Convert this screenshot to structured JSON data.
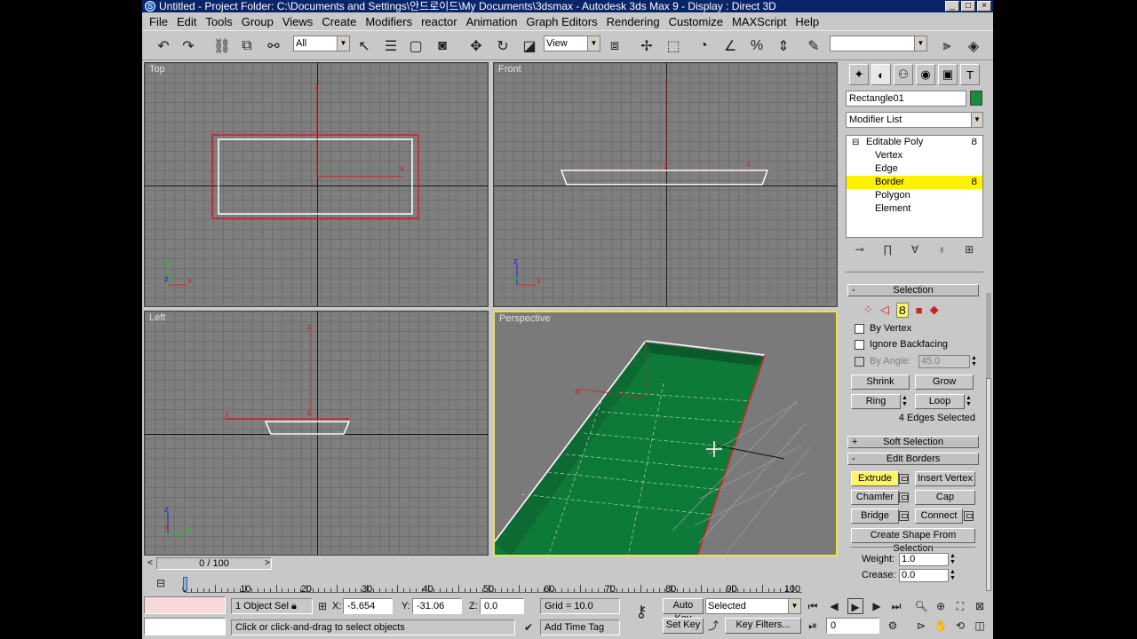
{
  "window": {
    "title": "Untitled      - Project Folder: C:\\Documents and Settings\\안드로이드\\My Documents\\3dsmax      - Autodesk 3ds Max 9      - Display : Direct 3D"
  },
  "menu": [
    "File",
    "Edit",
    "Tools",
    "Group",
    "Views",
    "Create",
    "Modifiers",
    "reactor",
    "Animation",
    "Graph Editors",
    "Rendering",
    "Customize",
    "MAXScript",
    "Help"
  ],
  "toolbar": {
    "selection_filter": "All",
    "ref_coord": "View",
    "named_sel": ""
  },
  "viewports": {
    "top": "Top",
    "front": "Front",
    "left": "Left",
    "perspective": "Perspective"
  },
  "panel": {
    "object_name": "Rectangle01",
    "object_color": "#1a8a3c",
    "modifier_list": "Modifier List",
    "stack": {
      "root": "Editable Poly",
      "items": [
        "Vertex",
        "Edge",
        "Border",
        "Polygon",
        "Element"
      ],
      "selected": "Border"
    },
    "selection": {
      "title": "Selection",
      "by_vertex": "By Vertex",
      "ignore_backfacing": "Ignore Backfacing",
      "by_angle": "By Angle:",
      "angle_value": "45.0",
      "shrink": "Shrink",
      "grow": "Grow",
      "ring": "Ring",
      "loop": "Loop",
      "status": "4 Edges Selected"
    },
    "soft_selection": "Soft Selection",
    "edit_borders": {
      "title": "Edit Borders",
      "extrude": "Extrude",
      "insert_vertex": "Insert Vertex",
      "chamfer": "Chamfer",
      "cap": "Cap",
      "bridge": "Bridge",
      "connect": "Connect",
      "create_shape": "Create Shape From Selection"
    },
    "weight_label": "Weight:",
    "weight_value": "1.0",
    "crease_label": "Crease:",
    "crease_value": "0.0"
  },
  "timeline": {
    "frame": "0 / 100",
    "ticks": [
      "0",
      "10",
      "20",
      "30",
      "40",
      "50",
      "60",
      "70",
      "80",
      "90",
      "100"
    ]
  },
  "status": {
    "selected_count": "1 Object Sel",
    "x_label": "X:",
    "x": "-5.654",
    "y_label": "Y:",
    "y": "-31.06",
    "z_label": "Z:",
    "z": "0.0",
    "grid": "Grid = 10.0",
    "prompt": "Click or click-and-drag to select objects",
    "add_time_tag": "Add Time Tag",
    "auto_key": "Auto Key",
    "set_key": "Set Key",
    "key_mode": "Selected",
    "key_filters": "Key Filters...",
    "frame_value": "0"
  }
}
